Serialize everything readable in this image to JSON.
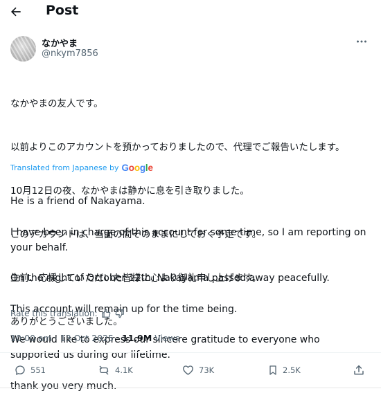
{
  "header": {
    "title": "Post",
    "back_icon": "arrow-left-icon"
  },
  "author": {
    "display_name": "なかやま",
    "handle": "@nkym7856"
  },
  "post": {
    "japanese_lines": [
      "なかやまの友人です。",
      "以前よりこのアカウントを預かっておりましたので、代理でご報告いたします。",
      "10月12日の夜、なかやまは静かに息を引き取りました。",
      "このアカウントは、当面の間そのままにしておく予定です。",
      "生前、応援していただいた皆様に心より御礼申し上げます。",
      "ありがとうございました。"
    ],
    "translated_label": "Translated from Japanese by",
    "translator": "Google",
    "english_lines": [
      "He is a friend of Nakayama.",
      "I have been in charge of this account for some time, so I am reporting on your behalf.",
      "On the night of October 12th, Nakayama passed away peacefully.",
      "This account will remain up for the time being.",
      "We would like to express our sincere gratitude to everyone who supported us during our lifetime.",
      "thank you very much."
    ],
    "rate_label": "Rate this translation:"
  },
  "meta": {
    "time": "10:00 am",
    "separator": "·",
    "date": "13 Oct 2025",
    "views_count": "11.9M",
    "views_label": "Views"
  },
  "actions": {
    "replies": "551",
    "reposts": "4.1K",
    "likes": "73K",
    "bookmarks": "2.5K"
  },
  "colors": {
    "link": "#1d9bf0",
    "text": "#0f1419",
    "secondary": "#536471"
  }
}
